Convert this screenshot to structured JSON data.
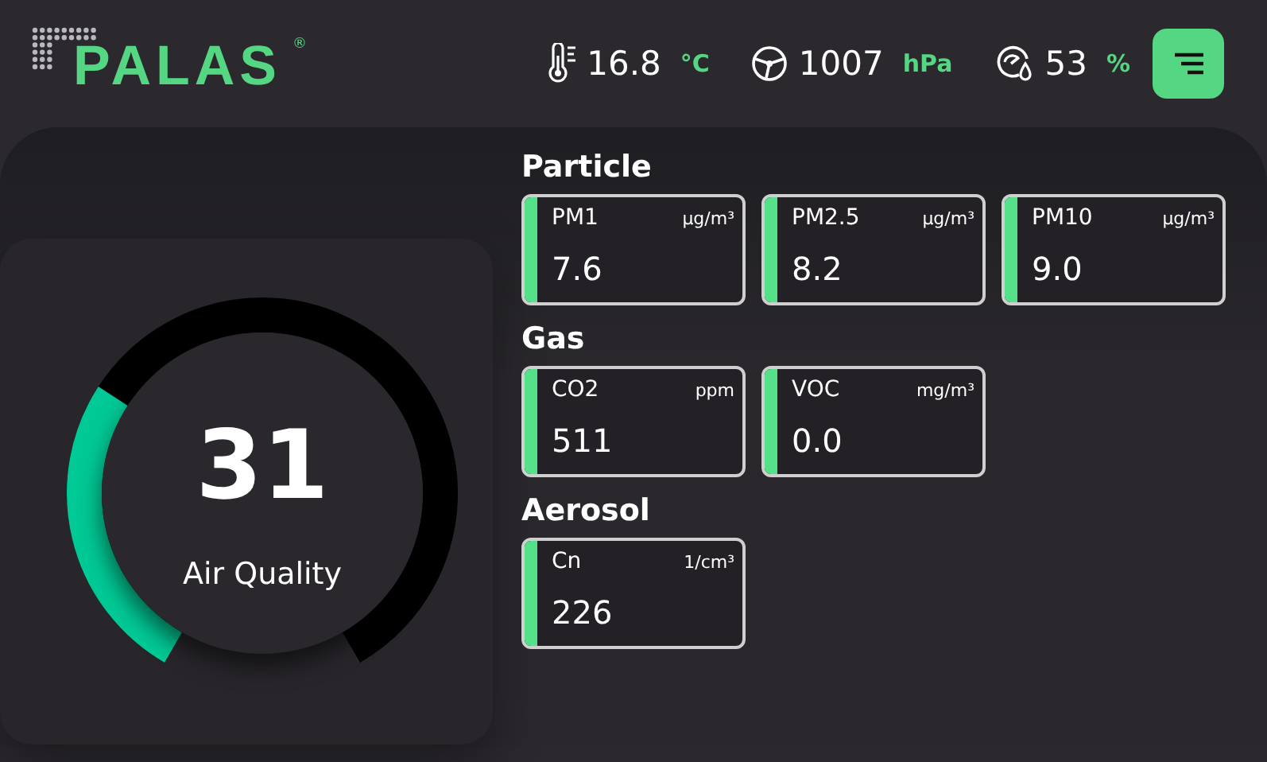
{
  "logo": {
    "text": "PALAS",
    "mark": "®"
  },
  "readings": [
    {
      "kind": "temperature",
      "value": "16.8",
      "unit": "°C"
    },
    {
      "kind": "pressure",
      "value": "1007",
      "unit": "hPa"
    },
    {
      "kind": "humidity",
      "value": "53",
      "unit": "%"
    }
  ],
  "gauge": {
    "value": "31",
    "label": "Air Quality"
  },
  "sections": [
    {
      "title": "Particle",
      "cards": [
        {
          "name": "PM1",
          "unit": "µg/m³",
          "value": "7.6"
        },
        {
          "name": "PM2.5",
          "unit": "µg/m³",
          "value": "8.2"
        },
        {
          "name": "PM10",
          "unit": "µg/m³",
          "value": "9.0"
        }
      ]
    },
    {
      "title": "Gas",
      "cards": [
        {
          "name": "CO2",
          "unit": "ppm",
          "value": "511"
        },
        {
          "name": "VOC",
          "unit": "mg/m³",
          "value": "0.0"
        }
      ]
    },
    {
      "title": "Aerosol",
      "cards": [
        {
          "name": "Cn",
          "unit": "1/cm³",
          "value": "226"
        }
      ]
    }
  ]
}
